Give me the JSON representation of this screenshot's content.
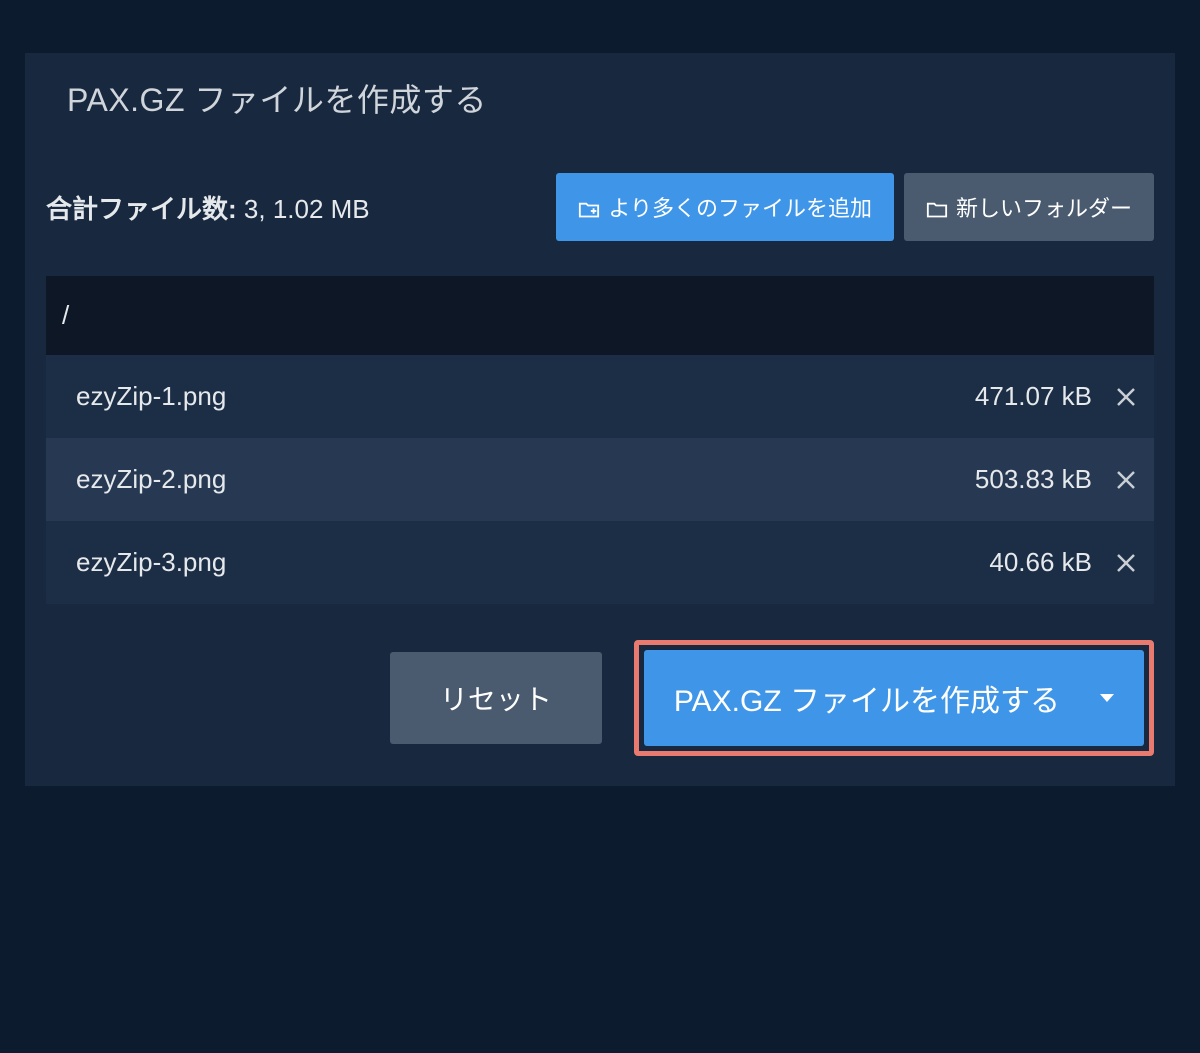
{
  "tab": {
    "title": "PAX.GZ ファイルを作成する"
  },
  "summary": {
    "label": "合計ファイル数:",
    "value": "3, 1.02 MB"
  },
  "buttons": {
    "add_more": "より多くのファイルを追加",
    "new_folder": "新しいフォルダー",
    "reset": "リセット",
    "create": "PAX.GZ ファイルを作成する"
  },
  "file_list": {
    "path": "/",
    "files": [
      {
        "name": "ezyZip-1.png",
        "size": "471.07 kB"
      },
      {
        "name": "ezyZip-2.png",
        "size": "503.83 kB"
      },
      {
        "name": "ezyZip-3.png",
        "size": "40.66 kB"
      }
    ]
  }
}
